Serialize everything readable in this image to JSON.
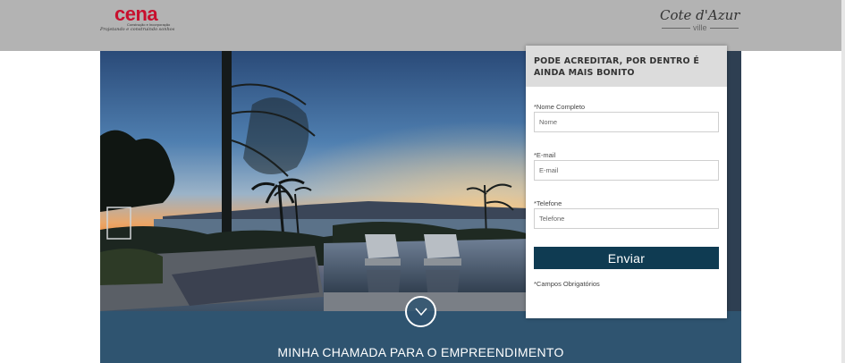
{
  "header": {
    "brand_left": {
      "name": "cena",
      "subtitle": "Construção e Incorporação",
      "tagline": "Projetando e construindo sonhos"
    },
    "brand_right": {
      "name": "Cote d'Azur",
      "sub": "ville"
    }
  },
  "hero": {
    "scroll_icon": "chevron-down-icon"
  },
  "band": {
    "title": "MINHA CHAMADA PARA O EMPREENDIMENTO"
  },
  "form": {
    "title": "PODE ACREDITAR, POR DENTRO É AINDA MAIS BONITO",
    "fields": [
      {
        "label": "*Nome Completo",
        "placeholder": "Nome",
        "value": ""
      },
      {
        "label": "*E-mail",
        "placeholder": "E-mail",
        "value": ""
      },
      {
        "label": "*Telefone",
        "placeholder": "Telefone",
        "value": ""
      }
    ],
    "submit_label": "Enviar",
    "required_note": "*Campos Obrigatórios"
  },
  "colors": {
    "header_bg": "#b3b3b3",
    "brand_red": "#c8102e",
    "band_bg": "#2f5470",
    "button_bg": "#0f3b52"
  }
}
